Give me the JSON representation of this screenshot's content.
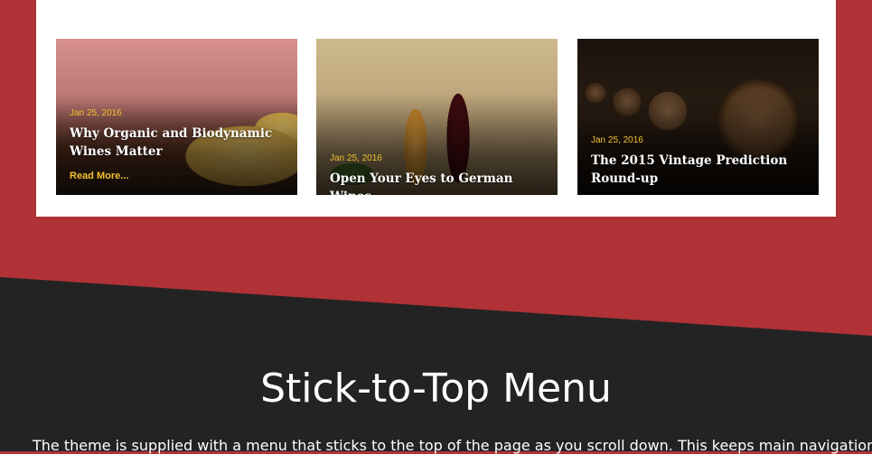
{
  "cards": [
    {
      "date": "Jan 25, 2016",
      "title": "Why Organic and Biodynamic Wines Matter",
      "read_more": "Read More..."
    },
    {
      "date": "Jan 25, 2016",
      "title": "Open Your Eyes to German Wines"
    },
    {
      "date": "Jan 25, 2016",
      "title": "The 2015 Vintage Prediction Round-up"
    }
  ],
  "section": {
    "title": "Stick-to-Top Menu",
    "description": "The theme is supplied with a menu that sticks to the top of the page as you scroll down. This keeps main navigation"
  },
  "colors": {
    "background_red": "#b03236",
    "dark_band": "#232323",
    "accent_yellow": "#f2c12e",
    "panel_white": "#ffffff"
  }
}
